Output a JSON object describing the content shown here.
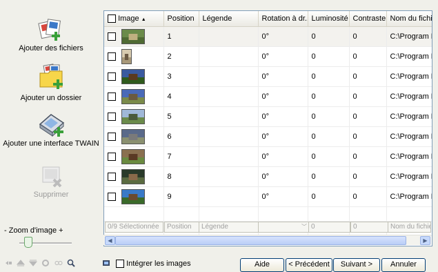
{
  "sidebar": {
    "add_files": "Ajouter des fichiers",
    "add_folder": "Ajouter un dossier",
    "add_twain": "Ajouter une interface TWAIN",
    "delete": "Supprimer",
    "zoom_label": "- Zoom d'image +"
  },
  "zoom": {
    "level": 0.1
  },
  "table": {
    "columns": [
      "Image",
      "Position",
      "Légende",
      "Rotation à dr...",
      "Luminosité",
      "Contraste",
      "Nom du fichier"
    ],
    "sort_indicator": "▲",
    "rows": [
      {
        "position": "1",
        "legend": "",
        "rotation": "0°",
        "luminosity": "0",
        "contrast": "0",
        "filename": "C:\\Program F"
      },
      {
        "position": "2",
        "legend": "",
        "rotation": "0°",
        "luminosity": "0",
        "contrast": "0",
        "filename": "C:\\Program F"
      },
      {
        "position": "3",
        "legend": "",
        "rotation": "0°",
        "luminosity": "0",
        "contrast": "0",
        "filename": "C:\\Program F"
      },
      {
        "position": "4",
        "legend": "",
        "rotation": "0°",
        "luminosity": "0",
        "contrast": "0",
        "filename": "C:\\Program F"
      },
      {
        "position": "5",
        "legend": "",
        "rotation": "0°",
        "luminosity": "0",
        "contrast": "0",
        "filename": "C:\\Program F"
      },
      {
        "position": "6",
        "legend": "",
        "rotation": "0°",
        "luminosity": "0",
        "contrast": "0",
        "filename": "C:\\Program F"
      },
      {
        "position": "7",
        "legend": "",
        "rotation": "0°",
        "luminosity": "0",
        "contrast": "0",
        "filename": "C:\\Program F"
      },
      {
        "position": "8",
        "legend": "",
        "rotation": "0°",
        "luminosity": "0",
        "contrast": "0",
        "filename": "C:\\Program F"
      },
      {
        "position": "9",
        "legend": "",
        "rotation": "0°",
        "luminosity": "0",
        "contrast": "0",
        "filename": "C:\\Program F"
      }
    ]
  },
  "filters": {
    "selected": "0/9 Sélectionnée",
    "position": "Position",
    "legend": "Légende",
    "luminosity": "0",
    "contrast": "0",
    "filename": "Nom du fichier"
  },
  "footer": {
    "integrate_label": "Intégrer les images",
    "help": "Aide",
    "previous": "< Précédent",
    "next": "Suivant >",
    "cancel": "Annuler"
  },
  "colors": {
    "accent": "#003c74",
    "grid_border": "#7f9db9",
    "plus_green": "#3aa03a"
  }
}
